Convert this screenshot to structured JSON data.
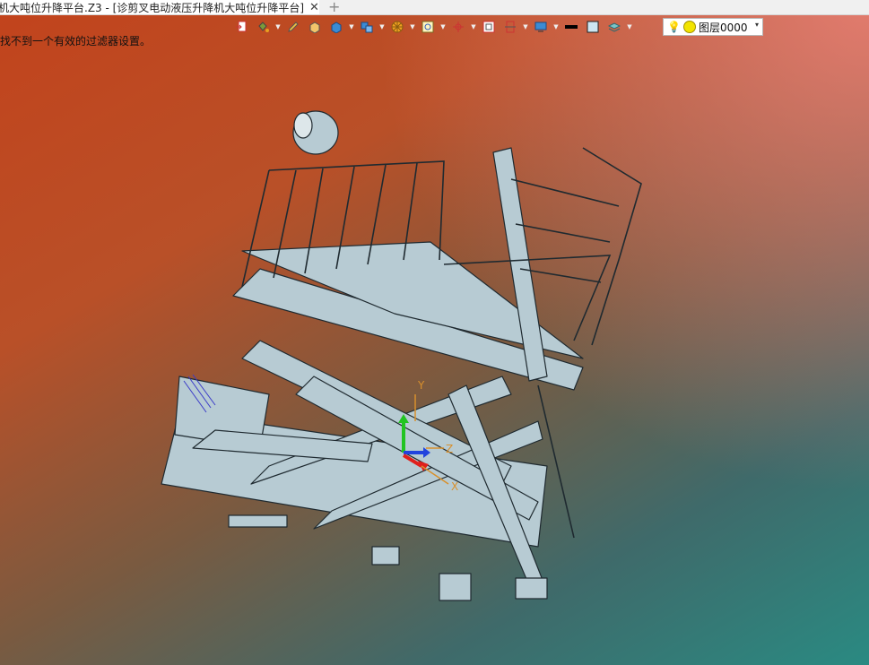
{
  "tab": {
    "title": "机大吨位升降平台.Z3 - [诊剪叉电动液压升降机大吨位升降平台]",
    "close": "✕",
    "add": "+"
  },
  "toolbar": {
    "icons": [
      "export-icon",
      "paint-bucket-icon",
      "pen-icon",
      "box-face-icon",
      "solid-box-icon",
      "multi-box-icon",
      "wheel-icon",
      "zoom-view-icon",
      "axis-icon",
      "frame-icon",
      "door-icon",
      "monitor-icon",
      "line-weight-icon",
      "color-swatch-icon",
      "layer-stack-icon"
    ]
  },
  "layer": {
    "label": "图层0000",
    "caret": "▾"
  },
  "status": {
    "message": "找不到一个有效的过滤器设置。"
  },
  "triad": {
    "x_label": "X",
    "y_label": "Y",
    "z_label": "Z"
  },
  "colors": {
    "tab_bg": "#f0f0f0",
    "model_fill": "#b7cbd3",
    "model_stroke": "#1f2a30",
    "triad_x": "#e0201c",
    "triad_y": "#22c422",
    "triad_z": "#2244dd",
    "triad_orange": "#d8902c"
  }
}
